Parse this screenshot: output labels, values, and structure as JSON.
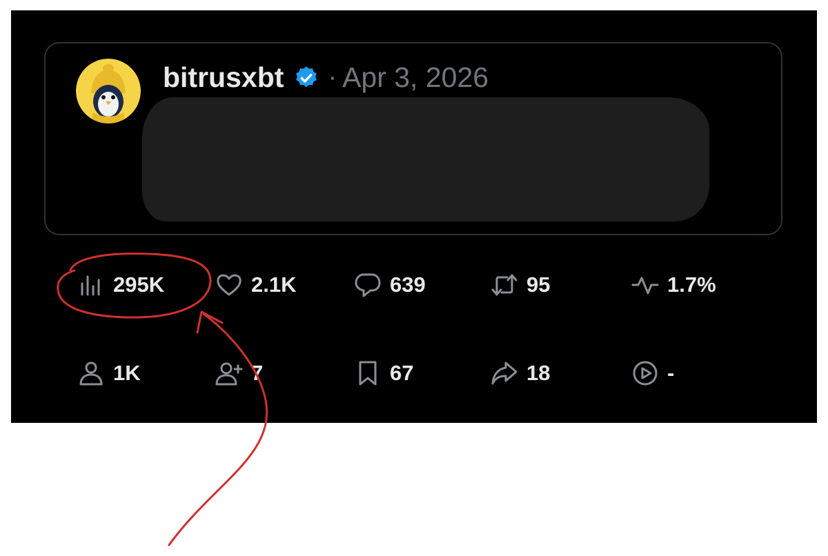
{
  "post": {
    "username": "bitrusxbt",
    "separator": "·",
    "date": "Apr 3, 2026"
  },
  "stats_row1": [
    {
      "icon": "views-icon",
      "value": "295K"
    },
    {
      "icon": "heart-icon",
      "value": "2.1K"
    },
    {
      "icon": "reply-icon",
      "value": "639"
    },
    {
      "icon": "retweet-icon",
      "value": "95"
    },
    {
      "icon": "engagement-rate-icon",
      "value": "1.7%"
    }
  ],
  "stats_row2": [
    {
      "icon": "profile-visits-icon",
      "value": "1K"
    },
    {
      "icon": "new-followers-icon",
      "value": "7"
    },
    {
      "icon": "bookmark-icon",
      "value": "67"
    },
    {
      "icon": "share-icon",
      "value": "18"
    },
    {
      "icon": "video-views-icon",
      "value": "-"
    }
  ],
  "colors": {
    "background": "#000000",
    "text": "#e7e9ea",
    "muted": "#71767b",
    "verified": "#1d9bf0",
    "annotation": "#d0312d"
  }
}
